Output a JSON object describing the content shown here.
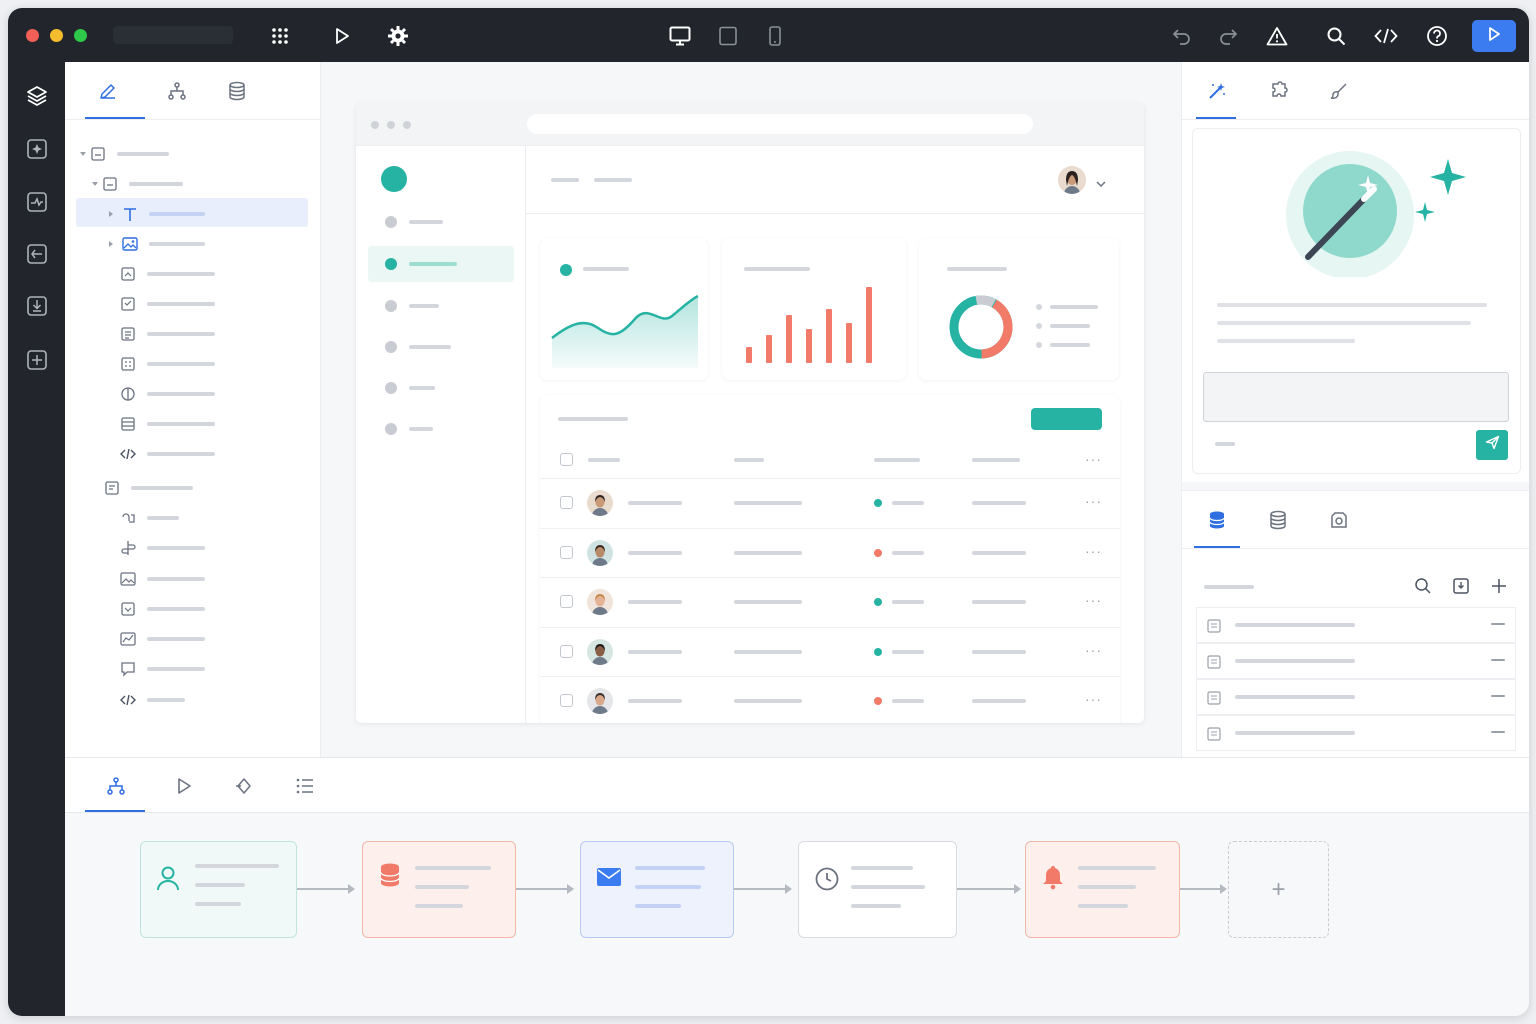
{
  "colors": {
    "accent_teal": "#26b3a3",
    "accent_coral": "#f27a68",
    "primary_blue": "#2f6fe0",
    "dark_chrome": "#22252c"
  },
  "toolbar": {
    "left_icons": [
      "apps-grid-icon",
      "play-icon",
      "settings-gear-icon"
    ],
    "device_icons": [
      "desktop-icon",
      "tablet-icon",
      "mobile-icon"
    ],
    "right_icons": [
      "undo-icon",
      "redo-icon",
      "warning-icon",
      "search-icon",
      "code-icon",
      "help-icon",
      "run-preview-icon"
    ]
  },
  "rail": {
    "icons": [
      "layers-icon",
      "component-add-icon",
      "page-icon",
      "module-icon",
      "import-icon",
      "widget-add-icon"
    ]
  },
  "left_panel": {
    "tabs": [
      "edit-pencil-icon",
      "hierarchy-icon",
      "database-icon"
    ],
    "active_tab": 0,
    "tree_icons": [
      "container-icon",
      "container-icon",
      "text-icon",
      "image-icon",
      "box-icon",
      "form-icon",
      "list-icon",
      "grid-icon",
      "toggle-icon",
      "table-icon",
      "code-icon",
      "section-icon",
      "hook-icon",
      "branch-icon",
      "picture-icon",
      "video-icon",
      "chart-icon",
      "comment-icon",
      "code-icon"
    ]
  },
  "canvas": {
    "mock_nav_items": 6,
    "active_nav": 1,
    "kpi_cards": [
      "line-chart",
      "bar-chart",
      "donut-chart"
    ],
    "table_status": [
      "teal",
      "coral",
      "teal",
      "teal",
      "coral"
    ]
  },
  "right_panel": {
    "tabs": [
      "magic-wand-icon",
      "puzzle-icon",
      "brush-icon"
    ],
    "active_tab": 0,
    "ai_input_placeholder": "",
    "data_tabs": [
      "database-icon",
      "database-stack-icon",
      "data-settings-icon"
    ],
    "data_active_tab": 0,
    "data_rows": 4
  },
  "bottom_panel": {
    "tabs": [
      "workflow-icon",
      "play-icon",
      "trigger-icon",
      "list-icon"
    ],
    "active_tab": 0,
    "flow_nodes": [
      "user-icon",
      "database-icon",
      "mail-icon",
      "clock-icon",
      "bell-icon"
    ],
    "add_node_symbol": "+"
  }
}
